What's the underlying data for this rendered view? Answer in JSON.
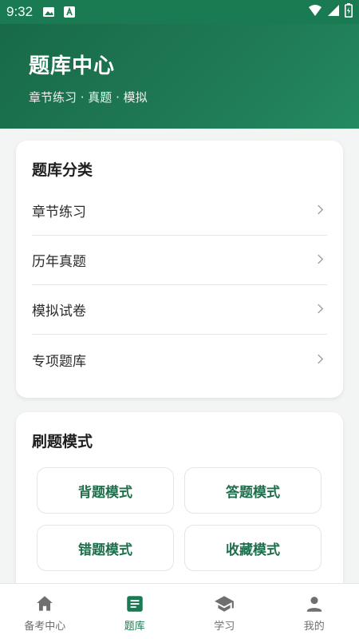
{
  "status_bar": {
    "time": "9:32"
  },
  "header": {
    "title": "题库中心",
    "subtitle": "章节练习 · 真题 · 模拟"
  },
  "categories": {
    "title": "题库分类",
    "items": [
      {
        "label": "章节练习"
      },
      {
        "label": "历年真题"
      },
      {
        "label": "模拟试卷"
      },
      {
        "label": "专项题库"
      }
    ]
  },
  "modes": {
    "title": "刷题模式",
    "buttons": [
      {
        "label": "背题模式"
      },
      {
        "label": "答题模式"
      },
      {
        "label": "错题模式"
      },
      {
        "label": "收藏模式"
      }
    ]
  },
  "bottom_nav": {
    "items": [
      {
        "label": "备考中心",
        "icon": "home-icon"
      },
      {
        "label": "题库",
        "icon": "question-bank-icon",
        "active": true
      },
      {
        "label": "学习",
        "icon": "graduation-cap-icon"
      },
      {
        "label": "我的",
        "icon": "person-icon"
      }
    ]
  },
  "colors": {
    "primary": "#1a7a52",
    "header_gradient_start": "#186a47",
    "header_gradient_end": "#248a60",
    "mode_text": "#1d6e4b",
    "background": "#f3f5f4"
  }
}
